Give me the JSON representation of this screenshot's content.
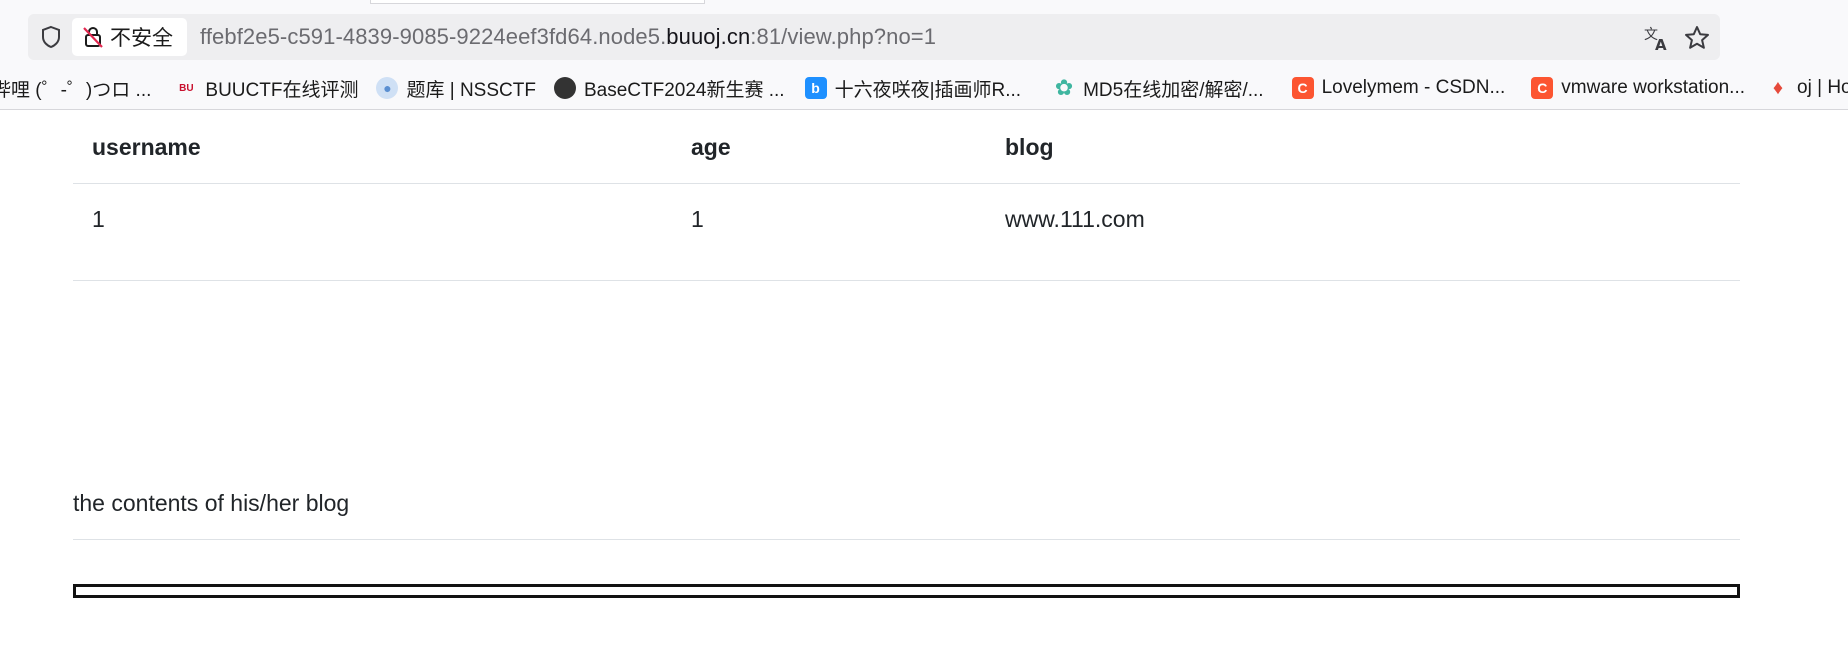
{
  "browser": {
    "security_label": "不安全",
    "url_prefix": "ffebf2e5-c591-4839-9085-9224eef3fd64.node5.",
    "url_host": "buuoj.cn",
    "url_suffix": ":81/view.php?no=1",
    "icons": {
      "shield": "shield-icon",
      "insecure": "insecure-lock-icon",
      "translate": "translate-icon",
      "bookmark": "star-icon"
    }
  },
  "bookmarks": [
    {
      "label": "哔哩 (゜-゜)つロ ...",
      "icon": "none"
    },
    {
      "label": "BUUCTF在线评测",
      "icon": "buuctf-icon",
      "color": "#c8102e"
    },
    {
      "label": "题库 | NSSCTF",
      "icon": "nssctf-icon",
      "color": "#5b8fd1"
    },
    {
      "label": "BaseCTF2024新生赛 ...",
      "icon": "basectf-icon",
      "color": "#333333"
    },
    {
      "label": "十六夜咲夜|插画师R...",
      "icon": "pixiv-icon",
      "color": "#1e90ff"
    },
    {
      "label": "MD5在线加密/解密/...",
      "icon": "flower-icon",
      "color": "#3fb6a0"
    },
    {
      "label": "Lovelymem - CSDN...",
      "icon": "csdn-icon",
      "color": "#fc5531"
    },
    {
      "label": "vmware workstation...",
      "icon": "csdn-icon",
      "color": "#fc5531"
    },
    {
      "label": "oj | Home",
      "icon": "balloon-icon",
      "color": "#e64a3b"
    }
  ],
  "table": {
    "headers": [
      "username",
      "age",
      "blog"
    ],
    "rows": [
      [
        "1",
        "1",
        "www.111.com"
      ]
    ]
  },
  "blog": {
    "heading": "the contents of his/her blog"
  }
}
